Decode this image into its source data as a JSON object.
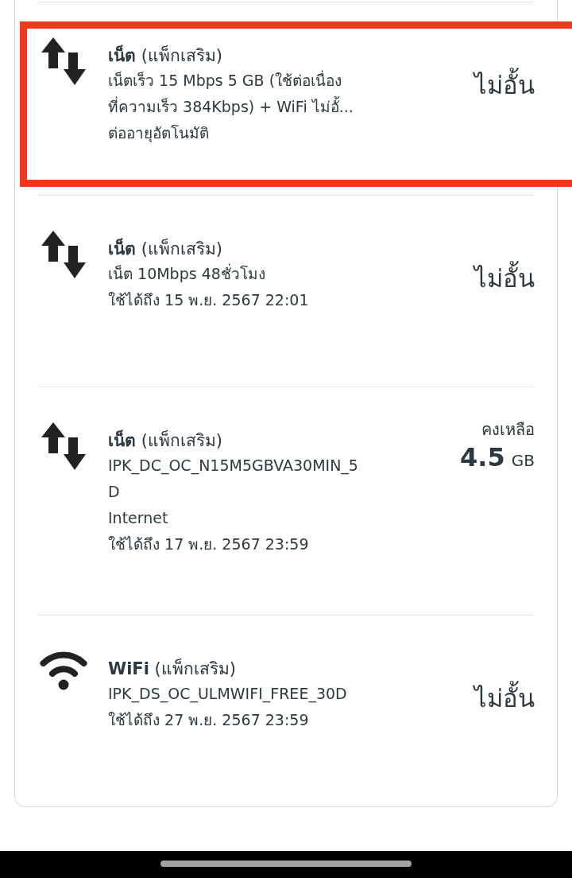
{
  "packages": [
    {
      "kind": "data",
      "highlighted": true,
      "title": "**เน็ต** (แพ็กเสริม)",
      "lines": [
        "เน็ตเร็ว 15 Mbps 5 GB (ใช้ต่อเนื่อง",
        "ที่ความเร็ว 384Kbps) + WiFi ไม่อั้...",
        "ต่ออายุอัตโนมัติ"
      ],
      "quota": {
        "kind": "unlimited",
        "label": "ไม่อั้น"
      }
    },
    {
      "kind": "data",
      "highlighted": false,
      "title": "**เน็ต** (แพ็กเสริม)",
      "lines": [
        "เน็ต 10Mbps 48ชั่วโมง",
        "ใช้ได้ถึง 15 พ.ย. 2567 22:01"
      ],
      "quota": {
        "kind": "unlimited",
        "label": "ไม่อั้น"
      }
    },
    {
      "kind": "data",
      "highlighted": false,
      "title": "**เน็ต** (แพ็กเสริม)",
      "lines": [
        "IPK_DC_OC_N15M5GBVA30MIN_5",
        "D",
        "Internet",
        "ใช้ได้ถึง 17 พ.ย. 2567 23:59"
      ],
      "quota": {
        "kind": "remaining",
        "label": "คงเหลือ",
        "value": "4.5",
        "unit": "GB"
      }
    },
    {
      "kind": "wifi",
      "highlighted": false,
      "title": "**WiFi** (แพ็กเสริม)",
      "lines": [
        "IPK_DS_OC_ULMWIFI_FREE_30D",
        "ใช้ได้ถึง 27 พ.ย. 2567 23:59"
      ],
      "quota": {
        "kind": "unlimited",
        "label": "ไม่อั้น"
      }
    }
  ]
}
